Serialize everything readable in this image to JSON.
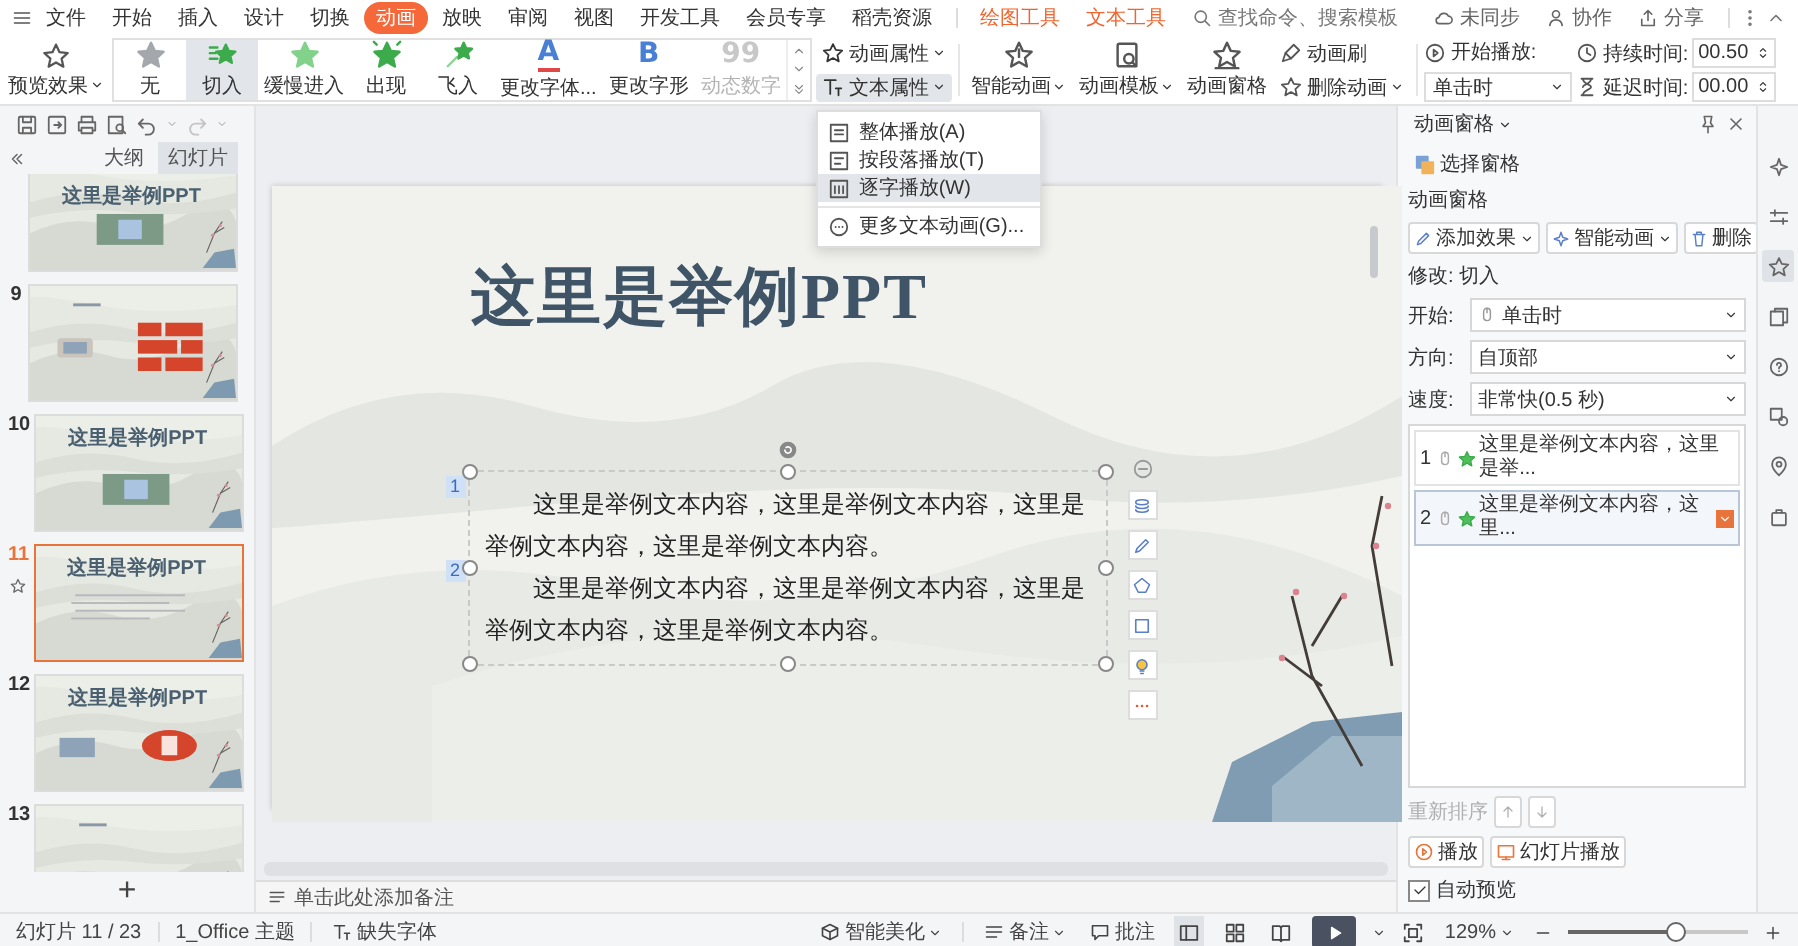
{
  "menu": {
    "items": [
      {
        "label": "文件",
        "selected": false
      },
      {
        "label": "开始",
        "selected": false
      },
      {
        "label": "插入",
        "selected": false
      },
      {
        "label": "设计",
        "selected": false
      },
      {
        "label": "切换",
        "selected": false
      },
      {
        "label": "动画",
        "selected": true
      },
      {
        "label": "放映",
        "selected": false
      },
      {
        "label": "审阅",
        "selected": false
      },
      {
        "label": "视图",
        "selected": false
      },
      {
        "label": "开发工具",
        "selected": false
      },
      {
        "label": "会员专享",
        "selected": false
      },
      {
        "label": "稻壳资源",
        "selected": false
      }
    ],
    "context_tabs": [
      "绘图工具",
      "文本工具"
    ],
    "search": {
      "placeholder": "查找命令、搜索模板"
    },
    "actions": [
      {
        "label": "未同步",
        "kind": "cloud"
      },
      {
        "label": "协作",
        "kind": "person"
      },
      {
        "label": "分享",
        "kind": "share"
      }
    ]
  },
  "ribbon": {
    "preview": {
      "label": "预览效果"
    },
    "effects": [
      {
        "label": "无",
        "kind": "none",
        "selected": false,
        "disabled": false
      },
      {
        "label": "切入",
        "kind": "wipe",
        "selected": true,
        "disabled": false
      },
      {
        "label": "缓慢进入",
        "kind": "fade",
        "selected": false,
        "disabled": false
      },
      {
        "label": "出现",
        "kind": "appear",
        "selected": false,
        "disabled": false
      },
      {
        "label": "飞入",
        "kind": "fly",
        "selected": false,
        "disabled": false
      },
      {
        "label": "更改字体...",
        "kind": "font",
        "glyph": "A",
        "selected": false,
        "disabled": false
      },
      {
        "label": "更改字形",
        "kind": "shape",
        "glyph": "B",
        "selected": false,
        "disabled": false
      },
      {
        "label": "动态数字",
        "kind": "number",
        "glyph": "99",
        "selected": false,
        "disabled": true
      }
    ],
    "text_props": [
      {
        "label": "动画属性",
        "kind": "anim",
        "expanded": false
      },
      {
        "label": "文本属性",
        "kind": "text",
        "expanded": true
      }
    ],
    "dropdown": [
      {
        "label": "整体播放(A)",
        "kind": "whole",
        "selected": false
      },
      {
        "label": "按段落播放(T)",
        "kind": "paragraph",
        "selected": false
      },
      {
        "label": "逐字播放(W)",
        "kind": "letter",
        "selected": true
      },
      {
        "label": "更多文本动画(G)...",
        "kind": "more",
        "selected": false
      }
    ],
    "big_buttons": [
      {
        "label": "智能动画",
        "kind": "smart",
        "dropdown": true
      },
      {
        "label": "动画模板",
        "kind": "template",
        "dropdown": true
      },
      {
        "label": "动画窗格",
        "kind": "pane",
        "dropdown": false
      }
    ],
    "small_buttons": [
      {
        "label": "动画刷",
        "kind": "brush",
        "dropdown": false
      },
      {
        "label": "删除动画",
        "kind": "delete",
        "dropdown": true
      }
    ],
    "start": {
      "label": "开始播放:",
      "value": "单击时"
    },
    "timing": [
      {
        "label": "持续时间:",
        "value": "00.50"
      },
      {
        "label": "延迟时间:",
        "value": "00.00"
      }
    ]
  },
  "quick_access": [
    {
      "kind": "save",
      "disabled": false
    },
    {
      "kind": "export",
      "disabled": false
    },
    {
      "kind": "print",
      "disabled": false
    },
    {
      "kind": "preview",
      "disabled": false
    },
    {
      "kind": "undo",
      "disabled": false
    },
    {
      "kind": "redo",
      "disabled": true
    }
  ],
  "sidebar": {
    "tabs": [
      {
        "label": "大纲",
        "selected": false
      },
      {
        "label": "幻灯片",
        "selected": true
      }
    ],
    "slides": [
      {
        "title": "这里是举例PPT",
        "selected": false,
        "animated": false
      },
      {
        "number": "9",
        "kind": "grid",
        "selected": false,
        "animated": false
      },
      {
        "number": "10",
        "title": "这里是举例PPT",
        "selected": false,
        "animated": false
      },
      {
        "number": "11",
        "title": "这里是举例PPT",
        "kind": "text",
        "selected": true,
        "animated": true
      },
      {
        "number": "12",
        "title": "这里是举例PPT",
        "kind": "two",
        "selected": false,
        "animated": false
      },
      {
        "number": "13",
        "kind": "plain",
        "selected": false,
        "animated": false
      }
    ],
    "add_slide": "+"
  },
  "slide": {
    "title": "这里是举例PPT",
    "paragraphs": [
      {
        "marker": "1",
        "text": "这里是举例文本内容，这里是举例文本内容，这里是举例文本内容，这里是举例文本内容。"
      },
      {
        "marker": "2",
        "text": "这里是举例文本内容，这里是举例文本内容，这里是举例文本内容，这里是举例文本内容。"
      }
    ]
  },
  "notes": {
    "placeholder": "单击此处添加备注"
  },
  "pane": {
    "title": "动画窗格",
    "select_pane": "选择窗格",
    "section": "动画窗格",
    "buttons": [
      {
        "label": "添加效果",
        "kind": "add",
        "dropdown": true
      },
      {
        "label": "智能动画",
        "kind": "smart",
        "dropdown": true
      },
      {
        "label": "删除",
        "kind": "delete",
        "dropdown": false
      }
    ],
    "modify": "修改: 切入",
    "fields": [
      {
        "label": "开始:",
        "value": "单击时",
        "kind": "mouse"
      },
      {
        "label": "方向:",
        "value": "自顶部",
        "kind": "plain"
      },
      {
        "label": "速度:",
        "value": "非常快(0.5 秒)",
        "kind": "plain"
      }
    ],
    "animations": [
      {
        "number": "1",
        "text": "这里是举例文本内容，这里是举...",
        "selected": false
      },
      {
        "number": "2",
        "text": "这里是举例文本内容，这里...",
        "selected": true
      }
    ],
    "reorder": {
      "label": "重新排序",
      "disabled": true
    },
    "play": [
      {
        "label": "播放",
        "kind": "play"
      },
      {
        "label": "幻灯片播放",
        "kind": "slideshow"
      }
    ],
    "autopreview": {
      "label": "自动预览",
      "checked": true
    }
  },
  "side_strip": [
    {
      "kind": "sparkle",
      "selected": false
    },
    {
      "kind": "sliders",
      "selected": false
    },
    {
      "kind": "star",
      "selected": true
    },
    {
      "kind": "copy",
      "selected": false
    },
    {
      "kind": "help",
      "selected": false
    },
    {
      "kind": "shape",
      "selected": false
    },
    {
      "kind": "pin",
      "selected": false
    },
    {
      "kind": "bag",
      "selected": false
    }
  ],
  "status_bar": {
    "slide": "幻灯片 11 / 23",
    "theme": "1_Office 主题",
    "missing_font": "缺失字体",
    "beautify": "智能美化",
    "notes": "备注",
    "comments": "批注",
    "views": [
      {
        "kind": "normal",
        "selected": true
      },
      {
        "kind": "sorter",
        "selected": false
      },
      {
        "kind": "reading",
        "selected": false
      }
    ],
    "zoom": "129%",
    "zoom_slider": {
      "level": 0.6
    }
  }
}
